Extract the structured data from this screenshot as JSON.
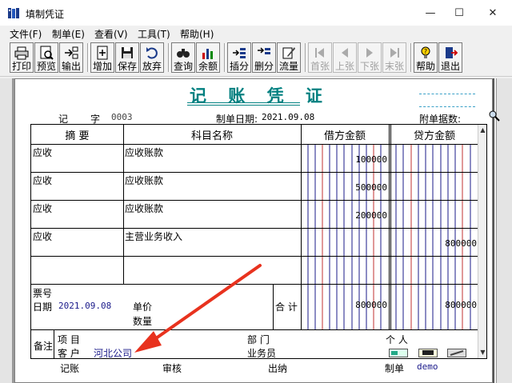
{
  "window": {
    "title": "填制凭证"
  },
  "menu": [
    "文件(F)",
    "制单(E)",
    "查看(V)",
    "工具(T)",
    "帮助(H)"
  ],
  "toolbar": {
    "print": "打印",
    "preview": "预览",
    "export": "输出",
    "add": "增加",
    "save": "保存",
    "abandon": "放弃",
    "query": "查询",
    "balance": "余额",
    "insert": "插分",
    "delete": "删分",
    "flow": "流量",
    "first": "首张",
    "prev": "上张",
    "next": "下张",
    "last": "末张",
    "help": "帮助",
    "exit": "退出"
  },
  "voucher": {
    "title": "记 账 凭 证",
    "type_label": "记",
    "no_label": "字",
    "no": "0003",
    "date_label": "制单日期:",
    "date": "2021.09.08",
    "attach_label": "附单据数:",
    "headers": {
      "summary": "摘 要",
      "account": "科目名称",
      "debit": "借方金额",
      "credit": "贷方金额"
    },
    "rows": [
      {
        "summary": "应收",
        "account": "应收账款",
        "debit": "100000",
        "credit": ""
      },
      {
        "summary": "应收",
        "account": "应收账款",
        "debit": "500000",
        "credit": ""
      },
      {
        "summary": "应收",
        "account": "应收账款",
        "debit": "200000",
        "credit": ""
      },
      {
        "summary": "应收",
        "account": "主营业务收入",
        "debit": "",
        "credit": "800000"
      },
      {
        "summary": "",
        "account": "",
        "debit": "",
        "credit": ""
      }
    ],
    "bill_no_label": "票号",
    "bill_date_label": "日期",
    "bill_date": "2021.09.08",
    "unit_price_label": "单价",
    "qty_label": "数量",
    "total_label": "合 计",
    "total_debit": "800000",
    "total_credit": "800000",
    "remark_label": "备注",
    "project_label": "项 目",
    "dept_label": "部 门",
    "person_label": "个 人",
    "customer_label": "客 户",
    "customer": "河北公司",
    "salesman_label": "业务员",
    "bookkeeper_label": "记账",
    "auditor_label": "审核",
    "cashier_label": "出纳",
    "maker_label": "制单",
    "maker": "demo"
  }
}
